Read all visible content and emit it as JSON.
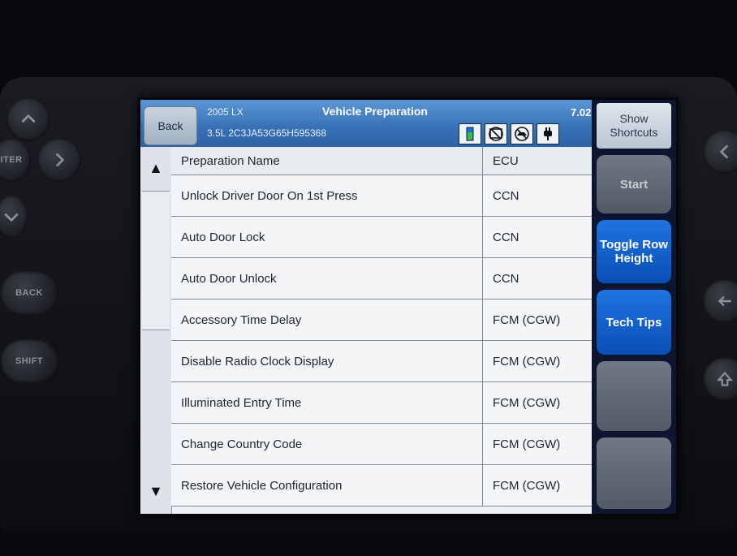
{
  "header": {
    "back_label": "Back",
    "vehicle_year_model": "2005 LX",
    "vehicle_engine_vin": "3.5L  2C3JA53G65H595368",
    "title": "Vehicle Preparation",
    "version": "7.02",
    "status_icons": [
      "battery-icon",
      "no-network-icon",
      "no-vehicle-comm-icon",
      "power-plug-icon"
    ]
  },
  "side_buttons": {
    "show_shortcuts": "Show Shortcuts",
    "start": "Start",
    "toggle_row_height": "Toggle Row Height",
    "tech_tips": "Tech Tips"
  },
  "hardware": {
    "enter_label": "ITER",
    "back_label": "BACK",
    "shift_label": "SHIFT"
  },
  "table": {
    "columns": [
      "Preparation Name",
      "ECU"
    ],
    "rows": [
      {
        "name": "Unlock Driver Door On 1st Press",
        "ecu": "CCN"
      },
      {
        "name": "Auto Door Lock",
        "ecu": "CCN"
      },
      {
        "name": "Auto Door Unlock",
        "ecu": "CCN"
      },
      {
        "name": "Accessory Time Delay",
        "ecu": "FCM (CGW)"
      },
      {
        "name": "Disable Radio Clock Display",
        "ecu": "FCM (CGW)"
      },
      {
        "name": "Illuminated Entry Time",
        "ecu": "FCM (CGW)"
      },
      {
        "name": "Change Country Code",
        "ecu": "FCM (CGW)"
      },
      {
        "name": "Restore Vehicle Configuration",
        "ecu": "FCM (CGW)"
      }
    ]
  },
  "colors": {
    "header_blue": "#3a72b8",
    "action_blue": "#0a4fb5",
    "disabled_grey": "#5f6772"
  }
}
